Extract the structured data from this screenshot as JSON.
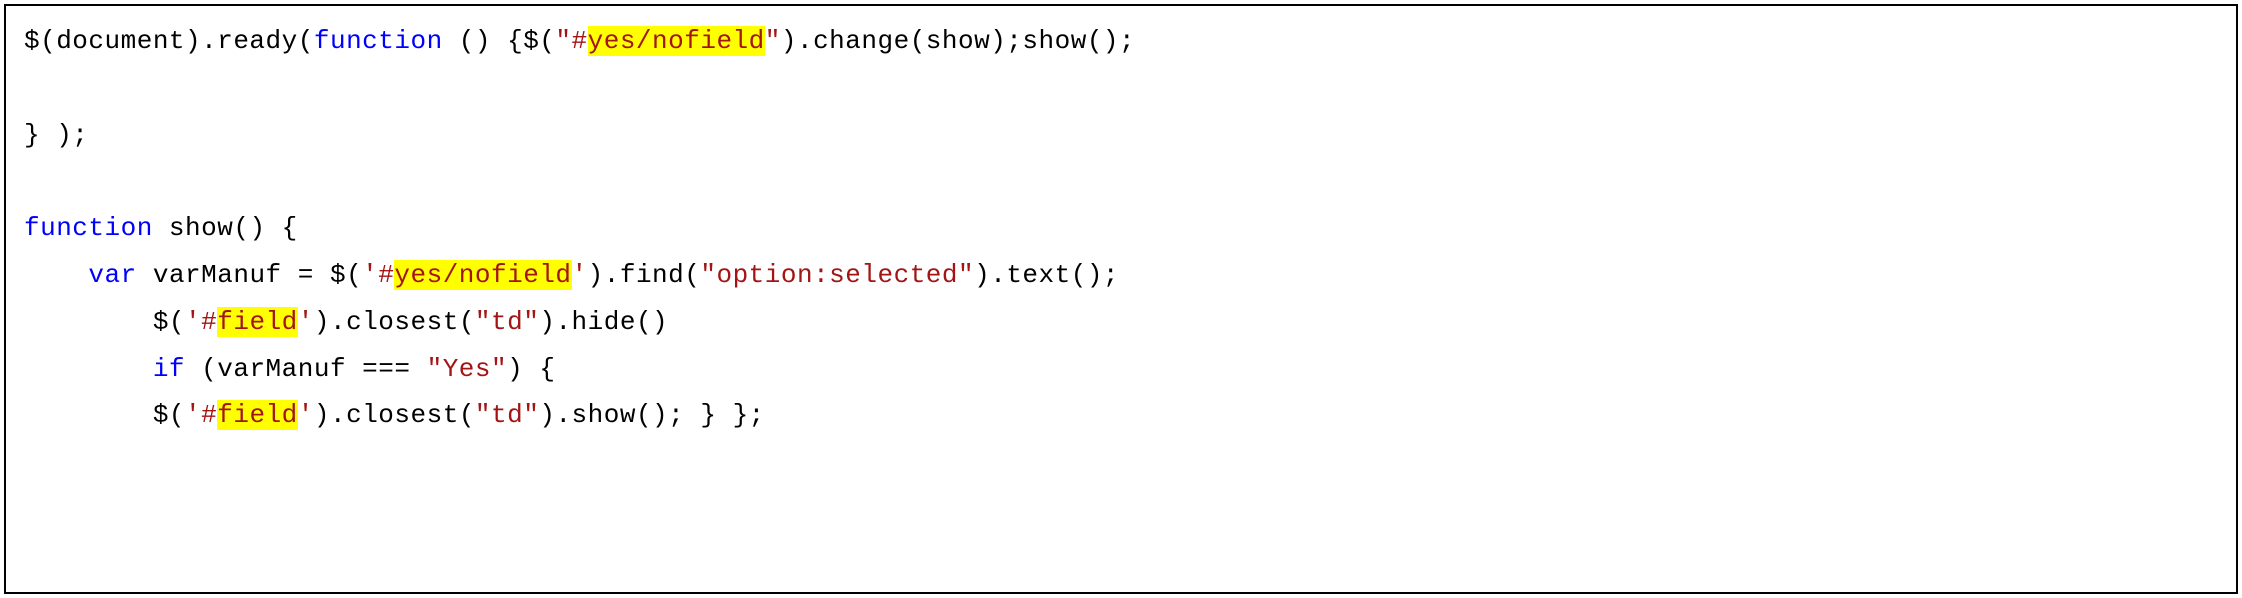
{
  "code": {
    "line1": {
      "p1": "$(document).ready(",
      "kw1": "function",
      "p2": " () {$(",
      "sq1": "\"#",
      "hl1": "yes/nofield",
      "sq2": "\"",
      "p3": ").change(show);show();"
    },
    "line2": "} );",
    "line3": {
      "kw1": "function",
      "p1": " show() {"
    },
    "line4": {
      "indent": "    ",
      "kw1": "var",
      "p1": " varManuf = $(",
      "sq1": "'#",
      "hl1": "yes/nofield",
      "sq2": "'",
      "p2": ").find(",
      "s2": "\"option:selected\"",
      "p3": ").text();"
    },
    "line5": {
      "indent": "        ",
      "p1": "$(",
      "sq1": "'#",
      "hl1": "field",
      "sq2": "'",
      "p2": ").closest(",
      "s2": "\"td\"",
      "p3": ").hide()"
    },
    "line6": {
      "indent": "        ",
      "kw1": "if",
      "p1": " (varManuf === ",
      "s1": "\"Yes\"",
      "p2": ") {"
    },
    "line7": {
      "indent": "        ",
      "p1": "$(",
      "sq1": "'#",
      "hl1": "field",
      "sq2": "'",
      "p2": ").closest(",
      "s2": "\"td\"",
      "p3": ").show(); } };"
    }
  }
}
